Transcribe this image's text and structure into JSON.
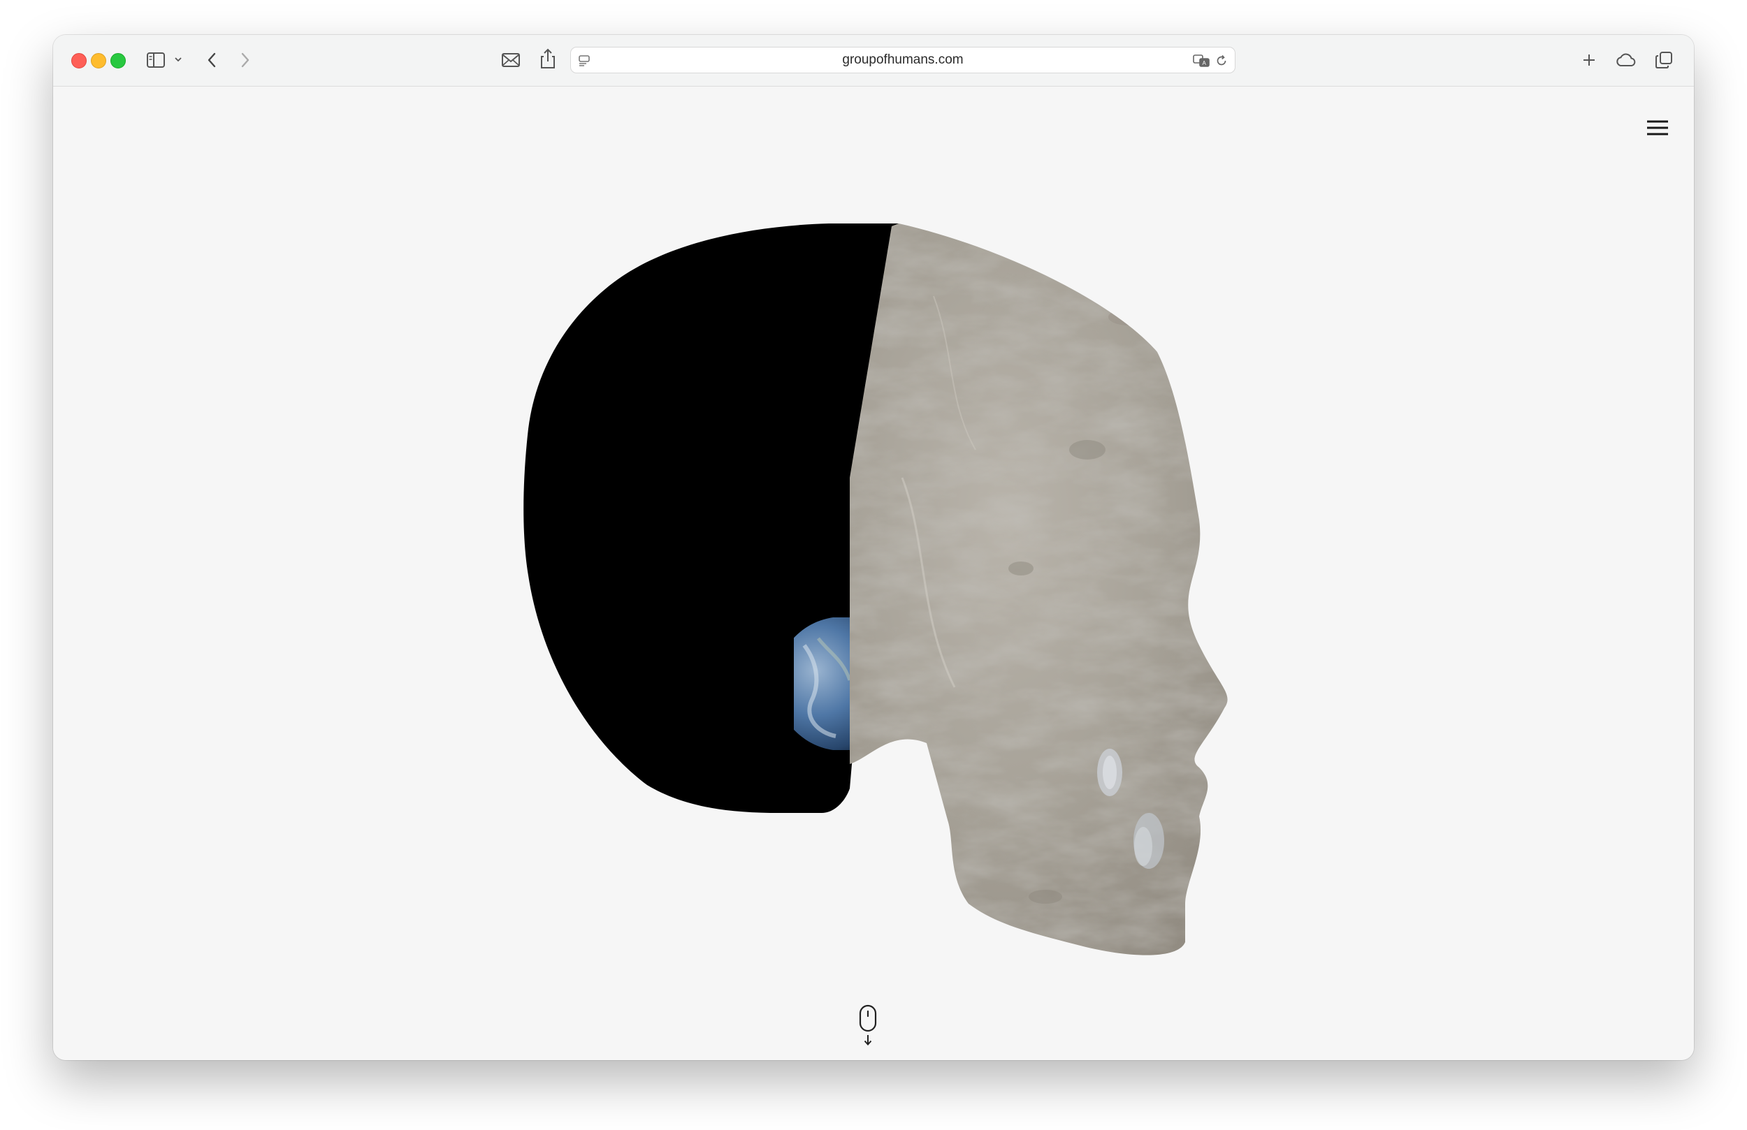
{
  "browser": {
    "address_bar": {
      "url_text": "groupofhumans.com"
    },
    "toolbar_icons": [
      "sidebar-icon",
      "chevron-down-icon",
      "back-arrow-icon",
      "forward-arrow-icon",
      "mail-icon",
      "share-icon",
      "page-settings-icon",
      "translate-icon",
      "reload-icon",
      "new-tab-plus-icon",
      "cloud-icon",
      "tab-overview-icon"
    ],
    "traffic_light_colors": {
      "close": "#fe5f57",
      "minimize": "#febc2e",
      "maximize": "#28c840"
    }
  },
  "page": {
    "background_color": "#f6f6f6",
    "menu_icon": "hamburger-menu-icon",
    "hero_graphic": "skull-silhouette-moon-earth",
    "scroll_hint_icon": "mouse-scroll-down-icon"
  }
}
